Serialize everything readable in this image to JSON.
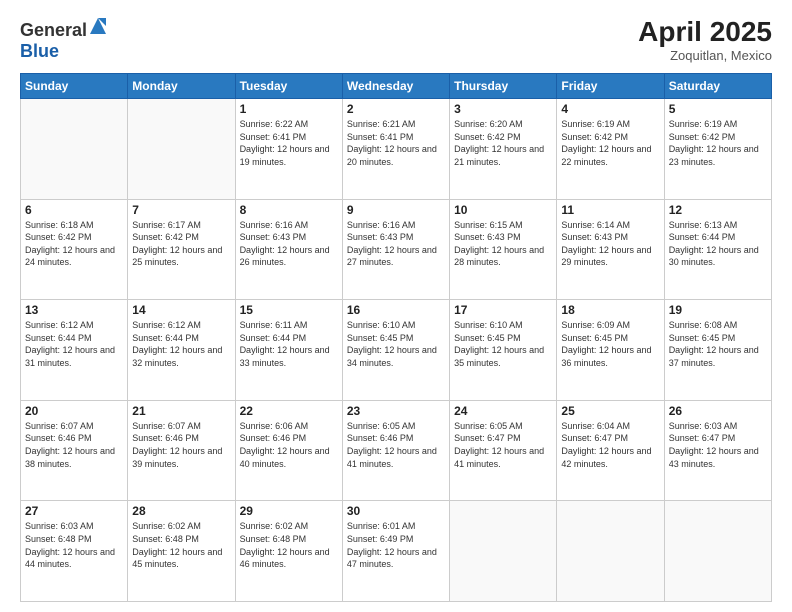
{
  "header": {
    "logo_general": "General",
    "logo_blue": "Blue",
    "title": "April 2025",
    "location": "Zoquitlan, Mexico"
  },
  "weekdays": [
    "Sunday",
    "Monday",
    "Tuesday",
    "Wednesday",
    "Thursday",
    "Friday",
    "Saturday"
  ],
  "weeks": [
    [
      {
        "day": "",
        "info": ""
      },
      {
        "day": "",
        "info": ""
      },
      {
        "day": "1",
        "info": "Sunrise: 6:22 AM\nSunset: 6:41 PM\nDaylight: 12 hours and 19 minutes."
      },
      {
        "day": "2",
        "info": "Sunrise: 6:21 AM\nSunset: 6:41 PM\nDaylight: 12 hours and 20 minutes."
      },
      {
        "day": "3",
        "info": "Sunrise: 6:20 AM\nSunset: 6:42 PM\nDaylight: 12 hours and 21 minutes."
      },
      {
        "day": "4",
        "info": "Sunrise: 6:19 AM\nSunset: 6:42 PM\nDaylight: 12 hours and 22 minutes."
      },
      {
        "day": "5",
        "info": "Sunrise: 6:19 AM\nSunset: 6:42 PM\nDaylight: 12 hours and 23 minutes."
      }
    ],
    [
      {
        "day": "6",
        "info": "Sunrise: 6:18 AM\nSunset: 6:42 PM\nDaylight: 12 hours and 24 minutes."
      },
      {
        "day": "7",
        "info": "Sunrise: 6:17 AM\nSunset: 6:42 PM\nDaylight: 12 hours and 25 minutes."
      },
      {
        "day": "8",
        "info": "Sunrise: 6:16 AM\nSunset: 6:43 PM\nDaylight: 12 hours and 26 minutes."
      },
      {
        "day": "9",
        "info": "Sunrise: 6:16 AM\nSunset: 6:43 PM\nDaylight: 12 hours and 27 minutes."
      },
      {
        "day": "10",
        "info": "Sunrise: 6:15 AM\nSunset: 6:43 PM\nDaylight: 12 hours and 28 minutes."
      },
      {
        "day": "11",
        "info": "Sunrise: 6:14 AM\nSunset: 6:43 PM\nDaylight: 12 hours and 29 minutes."
      },
      {
        "day": "12",
        "info": "Sunrise: 6:13 AM\nSunset: 6:44 PM\nDaylight: 12 hours and 30 minutes."
      }
    ],
    [
      {
        "day": "13",
        "info": "Sunrise: 6:12 AM\nSunset: 6:44 PM\nDaylight: 12 hours and 31 minutes."
      },
      {
        "day": "14",
        "info": "Sunrise: 6:12 AM\nSunset: 6:44 PM\nDaylight: 12 hours and 32 minutes."
      },
      {
        "day": "15",
        "info": "Sunrise: 6:11 AM\nSunset: 6:44 PM\nDaylight: 12 hours and 33 minutes."
      },
      {
        "day": "16",
        "info": "Sunrise: 6:10 AM\nSunset: 6:45 PM\nDaylight: 12 hours and 34 minutes."
      },
      {
        "day": "17",
        "info": "Sunrise: 6:10 AM\nSunset: 6:45 PM\nDaylight: 12 hours and 35 minutes."
      },
      {
        "day": "18",
        "info": "Sunrise: 6:09 AM\nSunset: 6:45 PM\nDaylight: 12 hours and 36 minutes."
      },
      {
        "day": "19",
        "info": "Sunrise: 6:08 AM\nSunset: 6:45 PM\nDaylight: 12 hours and 37 minutes."
      }
    ],
    [
      {
        "day": "20",
        "info": "Sunrise: 6:07 AM\nSunset: 6:46 PM\nDaylight: 12 hours and 38 minutes."
      },
      {
        "day": "21",
        "info": "Sunrise: 6:07 AM\nSunset: 6:46 PM\nDaylight: 12 hours and 39 minutes."
      },
      {
        "day": "22",
        "info": "Sunrise: 6:06 AM\nSunset: 6:46 PM\nDaylight: 12 hours and 40 minutes."
      },
      {
        "day": "23",
        "info": "Sunrise: 6:05 AM\nSunset: 6:46 PM\nDaylight: 12 hours and 41 minutes."
      },
      {
        "day": "24",
        "info": "Sunrise: 6:05 AM\nSunset: 6:47 PM\nDaylight: 12 hours and 41 minutes."
      },
      {
        "day": "25",
        "info": "Sunrise: 6:04 AM\nSunset: 6:47 PM\nDaylight: 12 hours and 42 minutes."
      },
      {
        "day": "26",
        "info": "Sunrise: 6:03 AM\nSunset: 6:47 PM\nDaylight: 12 hours and 43 minutes."
      }
    ],
    [
      {
        "day": "27",
        "info": "Sunrise: 6:03 AM\nSunset: 6:48 PM\nDaylight: 12 hours and 44 minutes."
      },
      {
        "day": "28",
        "info": "Sunrise: 6:02 AM\nSunset: 6:48 PM\nDaylight: 12 hours and 45 minutes."
      },
      {
        "day": "29",
        "info": "Sunrise: 6:02 AM\nSunset: 6:48 PM\nDaylight: 12 hours and 46 minutes."
      },
      {
        "day": "30",
        "info": "Sunrise: 6:01 AM\nSunset: 6:49 PM\nDaylight: 12 hours and 47 minutes."
      },
      {
        "day": "",
        "info": ""
      },
      {
        "day": "",
        "info": ""
      },
      {
        "day": "",
        "info": ""
      }
    ]
  ]
}
